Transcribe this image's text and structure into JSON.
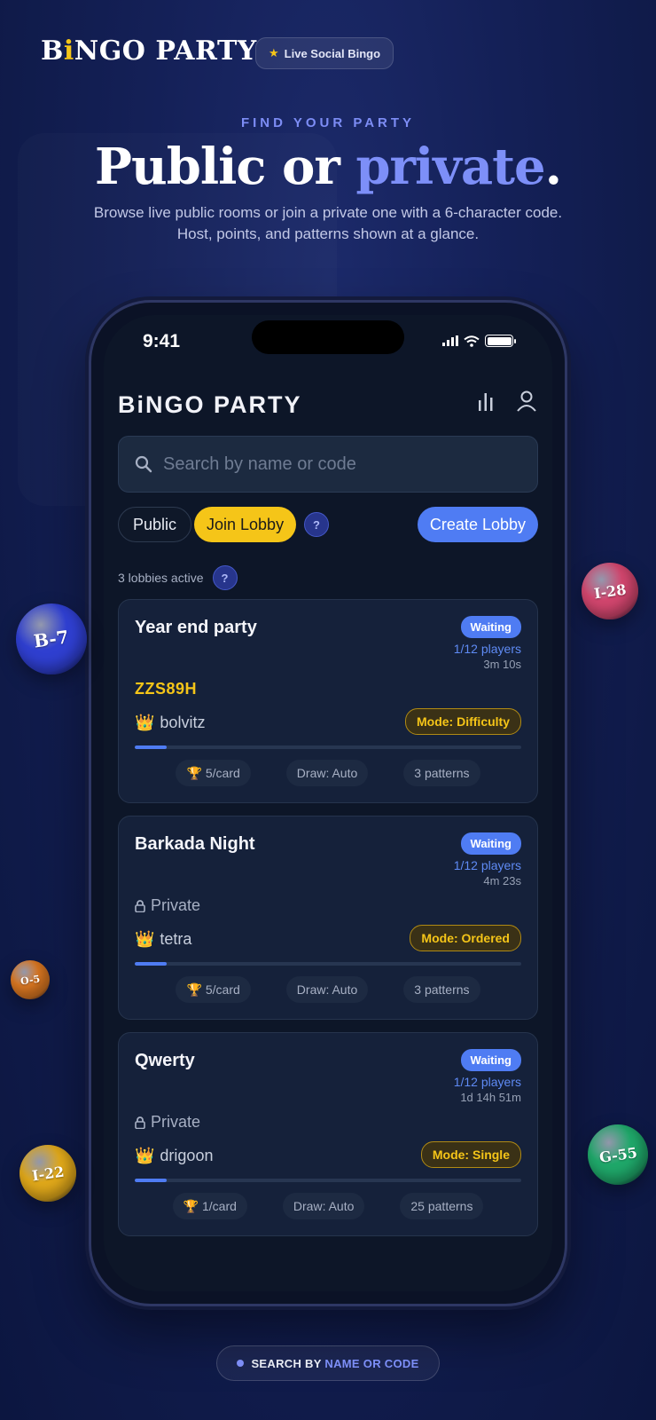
{
  "marketing": {
    "brand_prefix": "B",
    "brand_i": "i",
    "brand_suffix": "NGO PARTY",
    "badge_label": "Live Social Bingo",
    "eyebrow": "FIND YOUR PARTY",
    "headline_main": "Public or ",
    "headline_accent": "private",
    "headline_end": ".",
    "subtext": "Browse live public rooms or join a private one with a 6-character code. Host, points, and patterns shown at a glance.",
    "footer_prefix": "SEARCH BY ",
    "footer_highlight": "NAME OR CODE"
  },
  "status_bar": {
    "time": "9:41"
  },
  "app": {
    "title": "BiNGO PARTY",
    "search_placeholder": "Search by name or code",
    "filter_public": "Public",
    "filter_join": "Join Lobby",
    "help_glyph": "?",
    "create_button": "Create Lobby",
    "active_count": "3 lobbies active"
  },
  "lobbies": [
    {
      "name": "Year end party",
      "status": "Waiting",
      "players": "1/12 players",
      "elapsed": "3m 10s",
      "code": "ZZS89H",
      "host": "bolvitz",
      "mode": "Mode: Difficulty",
      "fill_fraction": 0.083,
      "points": "5/card",
      "draw": "Draw: Auto",
      "patterns": "3 patterns"
    },
    {
      "name": "Barkada Night",
      "status": "Waiting",
      "players": "1/12 players",
      "elapsed": "4m 23s",
      "private_label": "Private",
      "host": "tetra",
      "mode": "Mode: Ordered",
      "fill_fraction": 0.083,
      "points": "5/card",
      "draw": "Draw: Auto",
      "patterns": "3 patterns"
    },
    {
      "name": "Qwerty",
      "status": "Waiting",
      "players": "1/12 players",
      "elapsed": "1d 14h 51m",
      "private_label": "Private",
      "host": "drigoon",
      "mode": "Mode: Single",
      "fill_fraction": 0.083,
      "points": "1/card",
      "draw": "Draw: Auto",
      "patterns": "25 patterns"
    }
  ],
  "balls": {
    "b7": {
      "label": "B-7",
      "color": "#2f3fd0"
    },
    "i28": {
      "label": "I-28",
      "color": "#d2466e"
    },
    "o5": {
      "label": "O-5",
      "color": "#e07a22"
    },
    "g55": {
      "label": "G-55",
      "color": "#1fa86a"
    },
    "i22": {
      "label": "I-22",
      "color": "#e0a81a"
    }
  },
  "colors": {
    "accent_blue": "#4f7cf3",
    "accent_yellow": "#f5c518",
    "headline_accent": "#7d8ff8"
  }
}
